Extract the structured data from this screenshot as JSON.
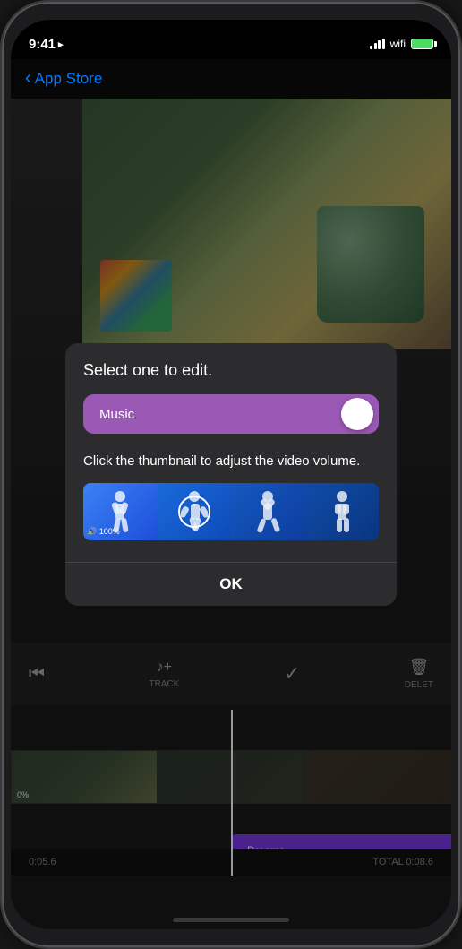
{
  "statusBar": {
    "time": "9:41",
    "locationIcon": "▶",
    "batteryFull": true
  },
  "navBar": {
    "backLabel": "App Store",
    "backChevron": "‹"
  },
  "dialog": {
    "title": "Select one to edit.",
    "toggleLabel": "Music",
    "subtitle": "Click the thumbnail to adjust the video volume.",
    "volumeBadge": "🔊 100%",
    "okLabel": "OK"
  },
  "timeline": {
    "videoVolume": "0%",
    "musicTrackLabel": "Dreams",
    "musicNoteIcon": "♪",
    "timestamp1": "0:05.6",
    "timestamp2": "TOTAL 0:08.6"
  },
  "toolbar": {
    "backIcon": "⏮",
    "checkIcon": "✓",
    "addTrackIcon": "♪+",
    "addTrackLabel": "TRACK",
    "deleteIcon": "🗑",
    "deleteLabel": "DELET"
  }
}
